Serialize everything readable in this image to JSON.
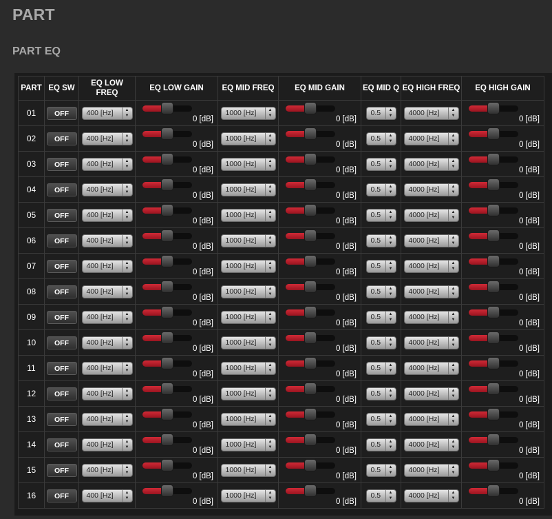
{
  "page": {
    "title": "PART",
    "section_title": "PART EQ"
  },
  "columns": {
    "part": "PART",
    "eq_sw": "EQ SW",
    "eq_low_freq": "EQ LOW FREQ",
    "eq_low_gain": "EQ LOW GAIN",
    "eq_mid_freq": "EQ MID FREQ",
    "eq_mid_gain": "EQ MID GAIN",
    "eq_mid_q": "EQ MID Q",
    "eq_high_freq": "EQ HIGH FREQ",
    "eq_high_gain": "EQ HIGH GAIN"
  },
  "colors": {
    "slider_fill": "#c0202c",
    "background": "#2b2b2b",
    "panel": "#1e1e1e"
  },
  "rows": [
    {
      "part": "01",
      "eq_sw": "OFF",
      "low_freq": "400 [Hz]",
      "low_gain": "0 [dB]",
      "low_gain_level": 0.5,
      "mid_freq": "1000 [Hz]",
      "mid_gain": "0 [dB]",
      "mid_gain_level": 0.5,
      "mid_q": "0.5",
      "high_freq": "4000 [Hz]",
      "high_gain": "0 [dB]",
      "high_gain_level": 0.5
    },
    {
      "part": "02",
      "eq_sw": "OFF",
      "low_freq": "400 [Hz]",
      "low_gain": "0 [dB]",
      "low_gain_level": 0.5,
      "mid_freq": "1000 [Hz]",
      "mid_gain": "0 [dB]",
      "mid_gain_level": 0.5,
      "mid_q": "0.5",
      "high_freq": "4000 [Hz]",
      "high_gain": "0 [dB]",
      "high_gain_level": 0.5
    },
    {
      "part": "03",
      "eq_sw": "OFF",
      "low_freq": "400 [Hz]",
      "low_gain": "0 [dB]",
      "low_gain_level": 0.5,
      "mid_freq": "1000 [Hz]",
      "mid_gain": "0 [dB]",
      "mid_gain_level": 0.5,
      "mid_q": "0.5",
      "high_freq": "4000 [Hz]",
      "high_gain": "0 [dB]",
      "high_gain_level": 0.5
    },
    {
      "part": "04",
      "eq_sw": "OFF",
      "low_freq": "400 [Hz]",
      "low_gain": "0 [dB]",
      "low_gain_level": 0.5,
      "mid_freq": "1000 [Hz]",
      "mid_gain": "0 [dB]",
      "mid_gain_level": 0.5,
      "mid_q": "0.5",
      "high_freq": "4000 [Hz]",
      "high_gain": "0 [dB]",
      "high_gain_level": 0.5
    },
    {
      "part": "05",
      "eq_sw": "OFF",
      "low_freq": "400 [Hz]",
      "low_gain": "0 [dB]",
      "low_gain_level": 0.5,
      "mid_freq": "1000 [Hz]",
      "mid_gain": "0 [dB]",
      "mid_gain_level": 0.5,
      "mid_q": "0.5",
      "high_freq": "4000 [Hz]",
      "high_gain": "0 [dB]",
      "high_gain_level": 0.5
    },
    {
      "part": "06",
      "eq_sw": "OFF",
      "low_freq": "400 [Hz]",
      "low_gain": "0 [dB]",
      "low_gain_level": 0.5,
      "mid_freq": "1000 [Hz]",
      "mid_gain": "0 [dB]",
      "mid_gain_level": 0.5,
      "mid_q": "0.5",
      "high_freq": "4000 [Hz]",
      "high_gain": "0 [dB]",
      "high_gain_level": 0.5
    },
    {
      "part": "07",
      "eq_sw": "OFF",
      "low_freq": "400 [Hz]",
      "low_gain": "0 [dB]",
      "low_gain_level": 0.5,
      "mid_freq": "1000 [Hz]",
      "mid_gain": "0 [dB]",
      "mid_gain_level": 0.5,
      "mid_q": "0.5",
      "high_freq": "4000 [Hz]",
      "high_gain": "0 [dB]",
      "high_gain_level": 0.5
    },
    {
      "part": "08",
      "eq_sw": "OFF",
      "low_freq": "400 [Hz]",
      "low_gain": "0 [dB]",
      "low_gain_level": 0.5,
      "mid_freq": "1000 [Hz]",
      "mid_gain": "0 [dB]",
      "mid_gain_level": 0.5,
      "mid_q": "0.5",
      "high_freq": "4000 [Hz]",
      "high_gain": "0 [dB]",
      "high_gain_level": 0.5
    },
    {
      "part": "09",
      "eq_sw": "OFF",
      "low_freq": "400 [Hz]",
      "low_gain": "0 [dB]",
      "low_gain_level": 0.5,
      "mid_freq": "1000 [Hz]",
      "mid_gain": "0 [dB]",
      "mid_gain_level": 0.5,
      "mid_q": "0.5",
      "high_freq": "4000 [Hz]",
      "high_gain": "0 [dB]",
      "high_gain_level": 0.5
    },
    {
      "part": "10",
      "eq_sw": "OFF",
      "low_freq": "400 [Hz]",
      "low_gain": "0 [dB]",
      "low_gain_level": 0.5,
      "mid_freq": "1000 [Hz]",
      "mid_gain": "0 [dB]",
      "mid_gain_level": 0.5,
      "mid_q": "0.5",
      "high_freq": "4000 [Hz]",
      "high_gain": "0 [dB]",
      "high_gain_level": 0.5
    },
    {
      "part": "11",
      "eq_sw": "OFF",
      "low_freq": "400 [Hz]",
      "low_gain": "0 [dB]",
      "low_gain_level": 0.5,
      "mid_freq": "1000 [Hz]",
      "mid_gain": "0 [dB]",
      "mid_gain_level": 0.5,
      "mid_q": "0.5",
      "high_freq": "4000 [Hz]",
      "high_gain": "0 [dB]",
      "high_gain_level": 0.5
    },
    {
      "part": "12",
      "eq_sw": "OFF",
      "low_freq": "400 [Hz]",
      "low_gain": "0 [dB]",
      "low_gain_level": 0.5,
      "mid_freq": "1000 [Hz]",
      "mid_gain": "0 [dB]",
      "mid_gain_level": 0.5,
      "mid_q": "0.5",
      "high_freq": "4000 [Hz]",
      "high_gain": "0 [dB]",
      "high_gain_level": 0.5
    },
    {
      "part": "13",
      "eq_sw": "OFF",
      "low_freq": "400 [Hz]",
      "low_gain": "0 [dB]",
      "low_gain_level": 0.5,
      "mid_freq": "1000 [Hz]",
      "mid_gain": "0 [dB]",
      "mid_gain_level": 0.5,
      "mid_q": "0.5",
      "high_freq": "4000 [Hz]",
      "high_gain": "0 [dB]",
      "high_gain_level": 0.5
    },
    {
      "part": "14",
      "eq_sw": "OFF",
      "low_freq": "400 [Hz]",
      "low_gain": "0 [dB]",
      "low_gain_level": 0.5,
      "mid_freq": "1000 [Hz]",
      "mid_gain": "0 [dB]",
      "mid_gain_level": 0.5,
      "mid_q": "0.5",
      "high_freq": "4000 [Hz]",
      "high_gain": "0 [dB]",
      "high_gain_level": 0.5
    },
    {
      "part": "15",
      "eq_sw": "OFF",
      "low_freq": "400 [Hz]",
      "low_gain": "0 [dB]",
      "low_gain_level": 0.5,
      "mid_freq": "1000 [Hz]",
      "mid_gain": "0 [dB]",
      "mid_gain_level": 0.5,
      "mid_q": "0.5",
      "high_freq": "4000 [Hz]",
      "high_gain": "0 [dB]",
      "high_gain_level": 0.5
    },
    {
      "part": "16",
      "eq_sw": "OFF",
      "low_freq": "400 [Hz]",
      "low_gain": "0 [dB]",
      "low_gain_level": 0.5,
      "mid_freq": "1000 [Hz]",
      "mid_gain": "0 [dB]",
      "mid_gain_level": 0.5,
      "mid_q": "0.5",
      "high_freq": "4000 [Hz]",
      "high_gain": "0 [dB]",
      "high_gain_level": 0.5
    }
  ]
}
